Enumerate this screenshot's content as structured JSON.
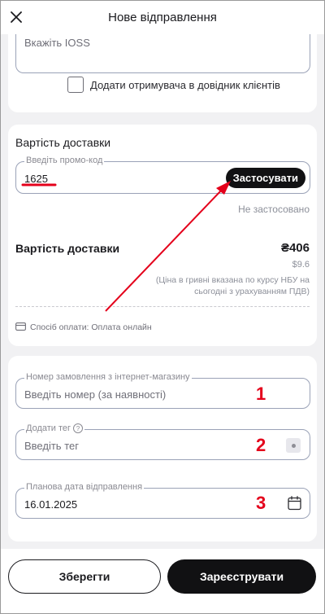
{
  "header": {
    "title": "Нове відправлення",
    "close_icon": "close-icon"
  },
  "ioss": {
    "placeholder": "Вкажіть IOSS"
  },
  "add_recipient": {
    "label": "Додати отримувача в довідник клієнтів",
    "checked": false
  },
  "delivery": {
    "section_title": "Вартість доставки",
    "promo_label": "Введіть промо-код",
    "promo_value": "1625",
    "apply_label": "Застосувати",
    "promo_status": "Не застосовано",
    "cost_label": "Вартість доставки",
    "cost_uah": "₴406",
    "cost_usd": "$9.6",
    "cost_note": "(Ціна в гривні вказана по курсу НБУ на сьогодні з урахуванням ПДВ)",
    "payment_method": "Спосіб оплати: Оплата онлайн",
    "payment_icon": "card-icon"
  },
  "extra": {
    "order_label": "Номер замовлення з інтернет-магазину",
    "order_placeholder": "Введіть номер (за наявності)",
    "tag_label": "Додати тег",
    "tag_placeholder": "Введіть тег",
    "date_label": "Планова дата відправлення",
    "date_value": "16.01.2025",
    "calendar_icon": "calendar-icon"
  },
  "annotations": {
    "marker_1": "1",
    "marker_2": "2",
    "marker_3": "3",
    "color": "#e4001b"
  },
  "actions": {
    "save_label": "Зберегти",
    "register_label": "Зареєструвати"
  },
  "colors": {
    "primary_button": "#111113",
    "field_border": "#9aa2b7",
    "background": "#f1f1f3"
  }
}
